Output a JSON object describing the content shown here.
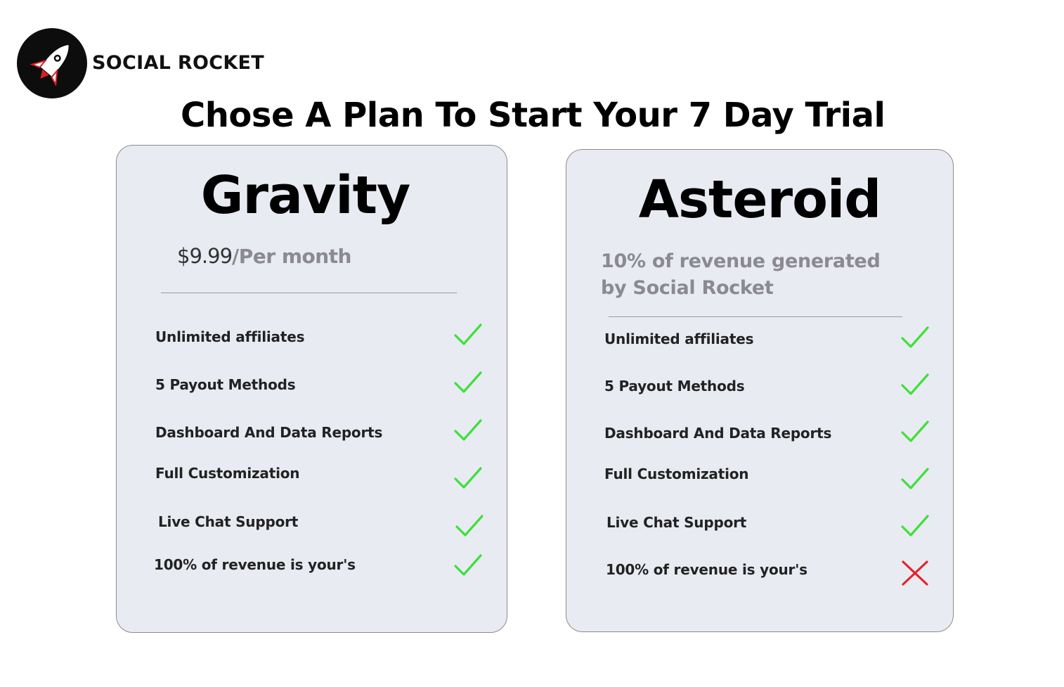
{
  "brand": {
    "name": "SOCIAL ROCKET",
    "logo_icon": "rocket-icon"
  },
  "headline": "Chose A Plan To Start Your 7 Day Trial",
  "colors": {
    "card_bg": "#e9ebf2",
    "check": "#3ee03a",
    "cross": "#e8232a",
    "muted_text": "#8a8a90"
  },
  "plans": [
    {
      "name": "Gravity",
      "price_amount": "$9.99",
      "price_period": "/Per month",
      "features": [
        {
          "label": "Unlimited affiliates",
          "included": true
        },
        {
          "label": "5 Payout Methods",
          "included": true
        },
        {
          "label": "Dashboard And Data Reports",
          "included": true
        },
        {
          "label": "Full Customization",
          "included": true
        },
        {
          "label": "Live Chat Support",
          "included": true
        },
        {
          "label": "100% of revenue is your's",
          "included": true
        }
      ]
    },
    {
      "name": "Asteroid",
      "price_description": "10% of revenue generated by Social Rocket",
      "features": [
        {
          "label": "Unlimited affiliates",
          "included": true
        },
        {
          "label": "5 Payout Methods",
          "included": true
        },
        {
          "label": "Dashboard And Data Reports",
          "included": true
        },
        {
          "label": "Full Customization",
          "included": true
        },
        {
          "label": "Live Chat Support",
          "included": true
        },
        {
          "label": "100% of revenue is your's",
          "included": false
        }
      ]
    }
  ]
}
